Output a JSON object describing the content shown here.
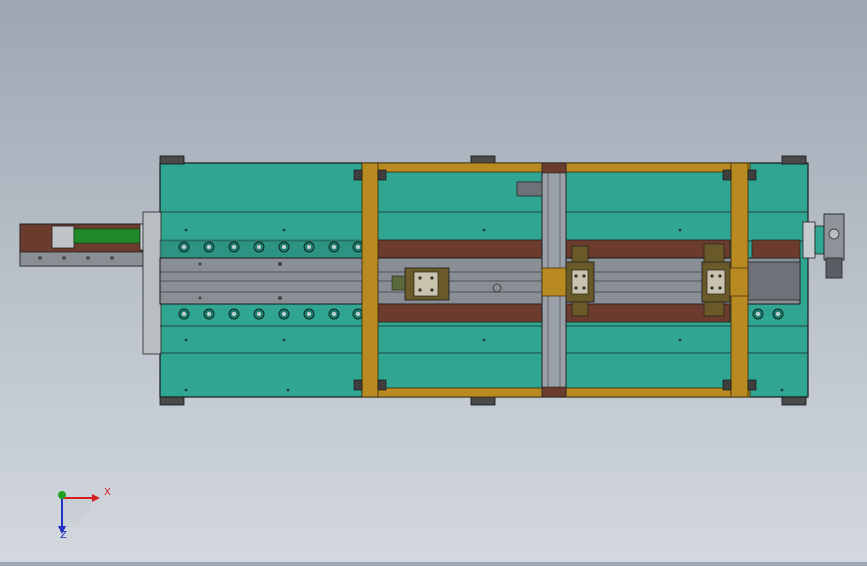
{
  "viewport": {
    "background_top": "#9ea6b2",
    "background_bottom": "#d3d8de"
  },
  "colors": {
    "plate": "#2fa592",
    "plate_light": "#48b8a6",
    "gantry": "#b98a22",
    "gantry_dark": "#8a6414",
    "rail_brown": "#6b3b2e",
    "rail_gray": "#8a8f96",
    "beam_gray": "#9aa0a8",
    "motor_green": "#1f8a2a",
    "bracket_dark": "#3a3a3a",
    "carriage": "#6a5a2a"
  },
  "triad": {
    "x_label": "X",
    "z_label": "Z",
    "x_color": "#d42020",
    "y_color": "#20a020",
    "z_color": "#2030c0"
  }
}
